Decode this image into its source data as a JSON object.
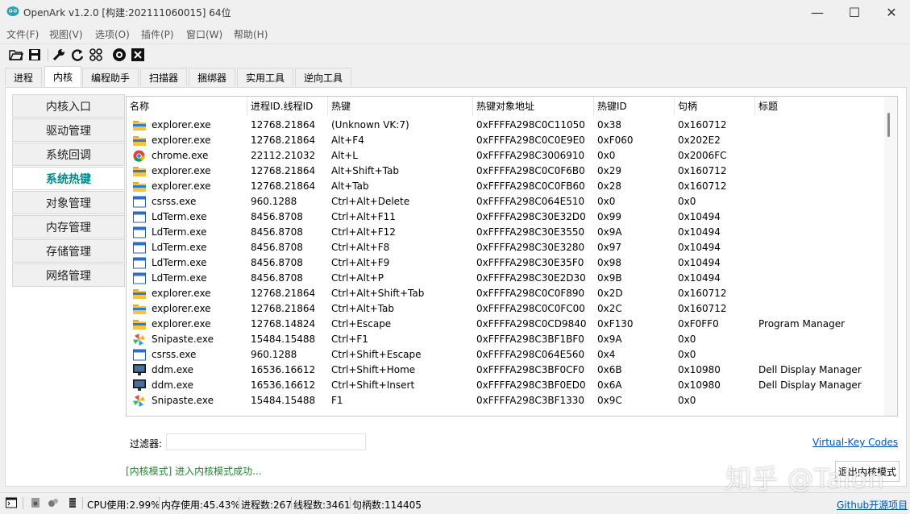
{
  "window": {
    "title": "OpenArk v1.2.0  [构建:202111060015]  64位",
    "minimize": "—",
    "maximize": "☐",
    "close": "✕"
  },
  "menu": [
    "文件(F)",
    "视图(V)",
    "选项(O)",
    "插件(P)",
    "窗口(W)",
    "帮助(H)"
  ],
  "toolbar": [
    "folder-open-icon",
    "save-icon",
    "wrench-icon",
    "refresh-icon",
    "grid-icon",
    "console-icon",
    "close-box-icon"
  ],
  "tabs": [
    "进程",
    "内核",
    "编程助手",
    "扫描器",
    "捆绑器",
    "实用工具",
    "逆向工具"
  ],
  "active_tab": "内核",
  "sidenav": [
    "内核入口",
    "驱动管理",
    "系统回调",
    "系统热键",
    "对象管理",
    "内存管理",
    "存储管理",
    "网络管理"
  ],
  "active_nav": "系统热键",
  "table": {
    "columns": [
      "名称",
      "进程ID.线程ID",
      "热键",
      "热键对象地址",
      "热键ID",
      "句柄",
      "标题"
    ],
    "rows": [
      {
        "icon": "folder-icon",
        "name": "explorer.exe",
        "pid": "12768.21864",
        "hotkey": "(Unknown VK:7)",
        "addr": "0xFFFFA298C0C11050",
        "id": "0x38",
        "handle": "0x160712",
        "title": ""
      },
      {
        "icon": "folder-icon",
        "name": "explorer.exe",
        "pid": "12768.21864",
        "hotkey": "Alt+F4",
        "addr": "0xFFFFA298C0C0E9E0",
        "id": "0xF060",
        "handle": "0x202E2",
        "title": ""
      },
      {
        "icon": "chrome-icon",
        "name": "chrome.exe",
        "pid": "22112.21032",
        "hotkey": "Alt+L",
        "addr": "0xFFFFA298C3006910",
        "id": "0x0",
        "handle": "0x2006FC",
        "title": ""
      },
      {
        "icon": "folder-icon",
        "name": "explorer.exe",
        "pid": "12768.21864",
        "hotkey": "Alt+Shift+Tab",
        "addr": "0xFFFFA298C0C0F6B0",
        "id": "0x29",
        "handle": "0x160712",
        "title": ""
      },
      {
        "icon": "folder-icon",
        "name": "explorer.exe",
        "pid": "12768.21864",
        "hotkey": "Alt+Tab",
        "addr": "0xFFFFA298C0C0FB60",
        "id": "0x28",
        "handle": "0x160712",
        "title": ""
      },
      {
        "icon": "app-window-icon",
        "name": "csrss.exe",
        "pid": "960.1288",
        "hotkey": "Ctrl+Alt+Delete",
        "addr": "0xFFFFA298C064E510",
        "id": "0x0",
        "handle": "0x0",
        "title": ""
      },
      {
        "icon": "app-window-icon",
        "name": "LdTerm.exe",
        "pid": "8456.8708",
        "hotkey": "Ctrl+Alt+F11",
        "addr": "0xFFFFA298C30E32D0",
        "id": "0x99",
        "handle": "0x10494",
        "title": ""
      },
      {
        "icon": "app-window-icon",
        "name": "LdTerm.exe",
        "pid": "8456.8708",
        "hotkey": "Ctrl+Alt+F12",
        "addr": "0xFFFFA298C30E3550",
        "id": "0x9A",
        "handle": "0x10494",
        "title": ""
      },
      {
        "icon": "app-window-icon",
        "name": "LdTerm.exe",
        "pid": "8456.8708",
        "hotkey": "Ctrl+Alt+F8",
        "addr": "0xFFFFA298C30E3280",
        "id": "0x97",
        "handle": "0x10494",
        "title": ""
      },
      {
        "icon": "app-window-icon",
        "name": "LdTerm.exe",
        "pid": "8456.8708",
        "hotkey": "Ctrl+Alt+F9",
        "addr": "0xFFFFA298C30E35F0",
        "id": "0x98",
        "handle": "0x10494",
        "title": ""
      },
      {
        "icon": "app-window-icon",
        "name": "LdTerm.exe",
        "pid": "8456.8708",
        "hotkey": "Ctrl+Alt+P",
        "addr": "0xFFFFA298C30E2D30",
        "id": "0x9B",
        "handle": "0x10494",
        "title": ""
      },
      {
        "icon": "folder-icon",
        "name": "explorer.exe",
        "pid": "12768.21864",
        "hotkey": "Ctrl+Alt+Shift+Tab",
        "addr": "0xFFFFA298C0C0F890",
        "id": "0x2D",
        "handle": "0x160712",
        "title": ""
      },
      {
        "icon": "folder-icon",
        "name": "explorer.exe",
        "pid": "12768.21864",
        "hotkey": "Ctrl+Alt+Tab",
        "addr": "0xFFFFA298C0C0FC00",
        "id": "0x2C",
        "handle": "0x160712",
        "title": ""
      },
      {
        "icon": "folder-icon",
        "name": "explorer.exe",
        "pid": "12768.14824",
        "hotkey": "Ctrl+Escape",
        "addr": "0xFFFFA298C0CD9840",
        "id": "0xF130",
        "handle": "0xF0FF0",
        "title": "Program Manager"
      },
      {
        "icon": "snipaste-icon",
        "name": "Snipaste.exe",
        "pid": "15484.15488",
        "hotkey": "Ctrl+F1",
        "addr": "0xFFFFA298C3BF1BF0",
        "id": "0x9A",
        "handle": "0x0",
        "title": ""
      },
      {
        "icon": "app-window-icon",
        "name": "csrss.exe",
        "pid": "960.1288",
        "hotkey": "Ctrl+Shift+Escape",
        "addr": "0xFFFFA298C064E560",
        "id": "0x4",
        "handle": "0x0",
        "title": ""
      },
      {
        "icon": "monitor-icon",
        "name": "ddm.exe",
        "pid": "16536.16612",
        "hotkey": "Ctrl+Shift+Home",
        "addr": "0xFFFFA298C3BF0CF0",
        "id": "0x6B",
        "handle": "0x10980",
        "title": "Dell Display Manager"
      },
      {
        "icon": "monitor-icon",
        "name": "ddm.exe",
        "pid": "16536.16612",
        "hotkey": "Ctrl+Shift+Insert",
        "addr": "0xFFFFA298C3BF0ED0",
        "id": "0x6A",
        "handle": "0x10980",
        "title": "Dell Display Manager"
      },
      {
        "icon": "snipaste-icon",
        "name": "Snipaste.exe",
        "pid": "15484.15488",
        "hotkey": "F1",
        "addr": "0xFFFFA298C3BF1330",
        "id": "0x9C",
        "handle": "0x0",
        "title": ""
      }
    ]
  },
  "filter": {
    "label": "过滤器:",
    "value": ""
  },
  "vk_link": "Virtual-Key Codes",
  "status_message": "[内核模式] 进入内核模式成功...",
  "exit_button": "退出内核模式",
  "watermark": "知乎 @Talon",
  "statusbar": {
    "cpu": "CPU使用:2.99%",
    "mem": "内存使用:45.43%",
    "procs": "进程数:267",
    "threads": "线程数:3461",
    "handles": "句柄数:114405",
    "github": "Github开源项目"
  },
  "colors": {
    "accent": "#00898d",
    "link": "#0057b8",
    "status_green": "#1c8a2c"
  }
}
